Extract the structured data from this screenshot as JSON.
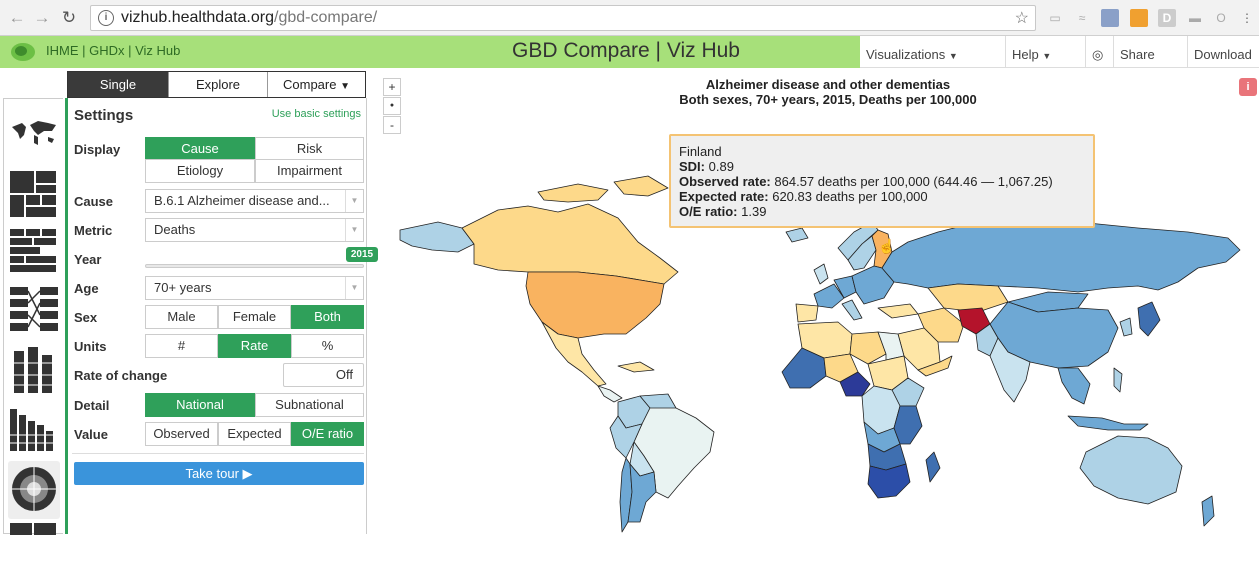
{
  "browser": {
    "url_host": "vizhub.healthdata.org",
    "url_path": "/gbd-compare/"
  },
  "header": {
    "links": "IHME | GHDx | Viz Hub",
    "title": "GBD Compare | Viz Hub",
    "nav": {
      "visualizations": "Visualizations",
      "help": "Help",
      "share": "Share",
      "download": "Download"
    }
  },
  "mode_tabs": {
    "single": "Single",
    "explore": "Explore",
    "compare": "Compare"
  },
  "settings": {
    "heading": "Settings",
    "basic_link": "Use basic settings",
    "display": {
      "label": "Display",
      "options": [
        "Cause",
        "Risk",
        "Etiology",
        "Impairment"
      ],
      "selected": "Cause"
    },
    "cause": {
      "label": "Cause",
      "value": "B.6.1 Alzheimer disease and..."
    },
    "metric": {
      "label": "Metric",
      "value": "Deaths"
    },
    "year": {
      "label": "Year",
      "value": "2015"
    },
    "age": {
      "label": "Age",
      "value": "70+ years"
    },
    "sex": {
      "label": "Sex",
      "options": [
        "Male",
        "Female",
        "Both"
      ],
      "selected": "Both"
    },
    "units": {
      "label": "Units",
      "options": [
        "#",
        "Rate",
        "%"
      ],
      "selected": "Rate"
    },
    "rate_of_change": {
      "label": "Rate of change",
      "toggle": "Off"
    },
    "detail": {
      "label": "Detail",
      "options": [
        "National",
        "Subnational"
      ],
      "selected": "National"
    },
    "value": {
      "label": "Value",
      "options": [
        "Observed",
        "Expected",
        "O/E ratio"
      ],
      "selected": "O/E ratio"
    },
    "tour_button": "Take tour ▶"
  },
  "map": {
    "title": "Alzheimer disease and other dementias",
    "subtitle": "Both sexes, 70+ years, 2015, Deaths per 100,000",
    "zoom_in": "+",
    "zoom_reset": "●",
    "zoom_out": "-",
    "info": "i"
  },
  "tooltip": {
    "country": "Finland",
    "sdi_label": "SDI:",
    "sdi_value": "0.89",
    "observed_label": "Observed rate:",
    "observed_value": "864.57 deaths per 100,000 (644.46 — 1,067.25)",
    "expected_label": "Expected rate:",
    "expected_value": "620.83 deaths per 100,000",
    "oe_label": "O/E ratio:",
    "oe_value": "1.39"
  },
  "colors": {
    "accent_green": "#2fa05a",
    "header_green": "#a7e07a",
    "tour_blue": "#3a94db",
    "tooltip_border": "#f4c373",
    "highlight_red": "#b4132b"
  }
}
